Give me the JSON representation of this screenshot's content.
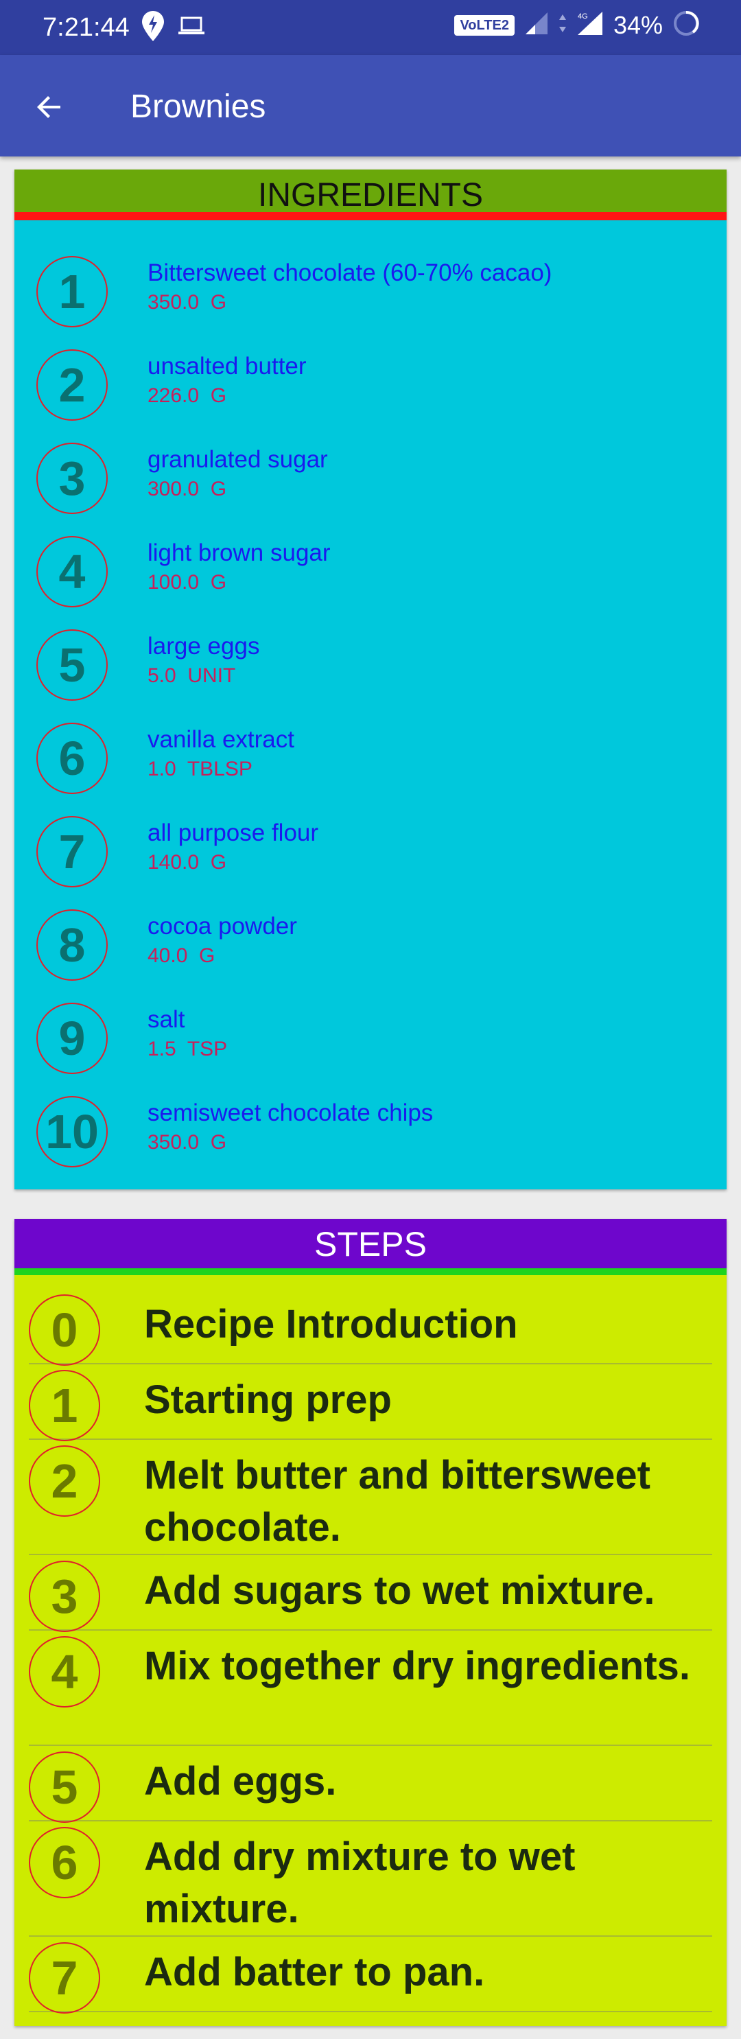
{
  "status_bar": {
    "time": "7:21:44",
    "network_label": "VoLTE2",
    "network_type": "4G",
    "battery": "34%"
  },
  "toolbar": {
    "title": "Brownies",
    "back_icon": "arrow-left-icon"
  },
  "ingredients": {
    "header": "INGREDIENTS",
    "items": [
      {
        "num": "1",
        "name": "Bittersweet chocolate (60-70% cacao)",
        "qty": "350.0  G"
      },
      {
        "num": "2",
        "name": "unsalted butter",
        "qty": "226.0  G"
      },
      {
        "num": "3",
        "name": "granulated sugar",
        "qty": "300.0  G"
      },
      {
        "num": "4",
        "name": "light brown sugar",
        "qty": "100.0  G"
      },
      {
        "num": "5",
        "name": "large eggs",
        "qty": "5.0  UNIT"
      },
      {
        "num": "6",
        "name": "vanilla extract",
        "qty": "1.0  TBLSP"
      },
      {
        "num": "7",
        "name": "all purpose flour",
        "qty": "140.0  G"
      },
      {
        "num": "8",
        "name": "cocoa powder",
        "qty": "40.0  G"
      },
      {
        "num": "9",
        "name": "salt",
        "qty": "1.5  TSP"
      },
      {
        "num": "10",
        "name": "semisweet chocolate chips",
        "qty": "350.0  G"
      }
    ]
  },
  "steps": {
    "header": "STEPS",
    "items": [
      {
        "num": "0",
        "text": "Recipe Introduction"
      },
      {
        "num": "1",
        "text": "Starting prep"
      },
      {
        "num": "2",
        "text": "Melt butter and bittersweet chocolate."
      },
      {
        "num": "3",
        "text": "Add sugars to wet mixture."
      },
      {
        "num": "4",
        "text": "Mix together dry ingredients."
      },
      {
        "num": "5",
        "text": "Add eggs."
      },
      {
        "num": "6",
        "text": "Add dry mixture to wet mixture."
      },
      {
        "num": "7",
        "text": "Add batter to pan."
      }
    ]
  },
  "colors": {
    "status_bar": "#303f9f",
    "toolbar": "#3f51b5",
    "ingredients_bg": "#00c8dc",
    "ingredients_header": "#6aa80a",
    "steps_bg": "#cdeb00",
    "steps_header": "#6e06cc"
  }
}
